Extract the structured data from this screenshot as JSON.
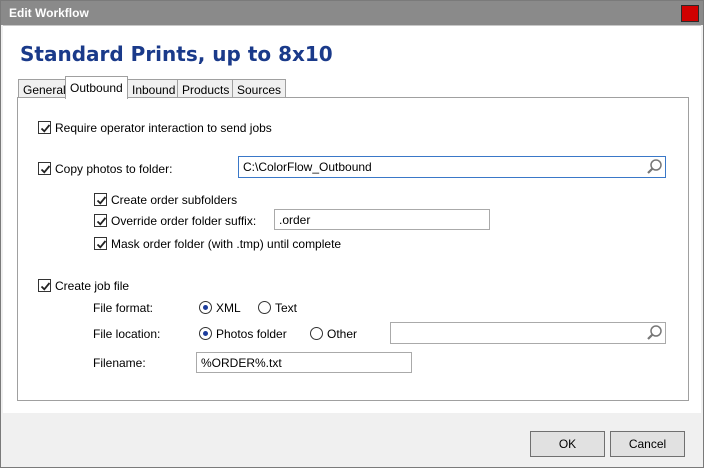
{
  "window": {
    "title": "Edit Workflow"
  },
  "heading": "Standard Prints, up to 8x10",
  "tabs": [
    {
      "label": "General",
      "active": false
    },
    {
      "label": "Outbound",
      "active": true
    },
    {
      "label": "Inbound",
      "active": false
    },
    {
      "label": "Products",
      "active": false
    },
    {
      "label": "Sources",
      "active": false
    }
  ],
  "outbound": {
    "require_operator": {
      "label": "Require operator interaction to send jobs",
      "checked": true
    },
    "copy_photos": {
      "label": "Copy photos to folder:",
      "checked": true,
      "path": "C:\\ColorFlow_Outbound"
    },
    "create_subfolders": {
      "label": "Create order subfolders",
      "checked": true
    },
    "override_suffix": {
      "label": "Override order folder suffix:",
      "checked": true,
      "value": ".order"
    },
    "mask_folder": {
      "label": "Mask order folder (with .tmp) until complete",
      "checked": true
    },
    "create_job_file": {
      "label": "Create job file",
      "checked": true
    },
    "file_format": {
      "label": "File format:",
      "options": [
        "XML",
        "Text"
      ],
      "selected": "XML"
    },
    "file_location": {
      "label": "File location:",
      "options": [
        "Photos folder",
        "Other"
      ],
      "selected": "Photos folder",
      "other_path": ""
    },
    "filename": {
      "label": "Filename:",
      "value": "%ORDER%.txt"
    }
  },
  "buttons": {
    "ok": "OK",
    "cancel": "Cancel"
  },
  "colors": {
    "heading": "#1a3a8a",
    "titlebar": "#8a8a8a",
    "close": "#d10000",
    "radio_dot": "#1c3c9c"
  }
}
